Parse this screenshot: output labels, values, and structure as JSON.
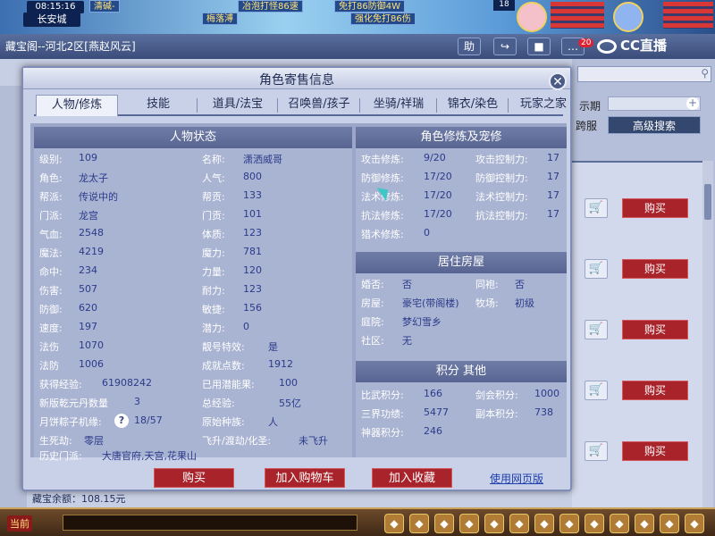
{
  "top_hud": {
    "clock": "08:15:16",
    "city": "长安城",
    "num": "18",
    "msgs": [
      "清碱-",
      "冶泡打怪86速",
      "免打86防御4W",
      "强化免打86伤"
    ],
    "hint": "梅落溥"
  },
  "outer": {
    "title": "藏宝阁--河北2区[燕赵风云]",
    "btn_help": "助",
    "msg_count": "20",
    "brand": "CC直播",
    "row1_label": "示期",
    "row2_label": "跨服",
    "adv_search": "高级搜索",
    "buy": "购买",
    "bottom_text": "藏宝余额：108.15元"
  },
  "dialog": {
    "title": "角色寄售信息",
    "tabs": [
      "人物/修炼",
      "技能",
      "道具/法宝",
      "召唤兽/孩子",
      "坐骑/祥瑞",
      "锦衣/染色",
      "玩家之家"
    ],
    "active_tab": 0
  },
  "char_status": {
    "title": "人物状态",
    "left": [
      {
        "k": "级别:",
        "v": "109"
      },
      {
        "k": "角色:",
        "v": "龙太子"
      },
      {
        "k": "帮派:",
        "v": "传说中的"
      },
      {
        "k": "门派:",
        "v": "龙宫"
      },
      {
        "k": "气血:",
        "v": "2548"
      },
      {
        "k": "魔法:",
        "v": "4219"
      },
      {
        "k": "命中:",
        "v": "234"
      },
      {
        "k": "伤害:",
        "v": "507"
      },
      {
        "k": "防御:",
        "v": "620"
      },
      {
        "k": "速度:",
        "v": "197"
      },
      {
        "k": "法伤",
        "v": "1070"
      },
      {
        "k": "法防",
        "v": "1006"
      }
    ],
    "right": [
      {
        "k": "名称:",
        "v": "潇洒威哥"
      },
      {
        "k": "人气:",
        "v": "800"
      },
      {
        "k": "帮贡:",
        "v": "133"
      },
      {
        "k": "门贡:",
        "v": "101"
      },
      {
        "k": "体质:",
        "v": "123"
      },
      {
        "k": "魔力:",
        "v": "781"
      },
      {
        "k": "力量:",
        "v": "120"
      },
      {
        "k": "耐力:",
        "v": "123"
      },
      {
        "k": "敏捷:",
        "v": "156"
      },
      {
        "k": "潜力:",
        "v": "0"
      },
      {
        "k": "靓号特效:",
        "v": "是"
      },
      {
        "k": "成就点数:",
        "v": "1912"
      }
    ],
    "exp_label": "获得经验:",
    "exp_value": "61908242",
    "potential_label": "已用潜能果:",
    "potential_value": "100",
    "qianyuan_label": "新版乾元丹数量",
    "qianyuan_value": "3",
    "total_exp_label": "总经验:",
    "total_exp_value": "55亿",
    "mooncake_label": "月饼粽子机缘:",
    "mooncake_help": "?",
    "mooncake_value": "18/57",
    "race_label": "原始种族:",
    "race_value": "人",
    "life_label": "生死劫:",
    "life_value": "零层",
    "ascend_label": "飞升/渡劫/化圣:",
    "ascend_value": "未飞升",
    "history_label": "历史门派:",
    "history_value": "大唐官府,天宫,花果山"
  },
  "practice": {
    "title": "角色修炼及宠修",
    "rows": [
      {
        "k1": "攻击修炼:",
        "v1": "9/20",
        "k2": "攻击控制力:",
        "v2": "17"
      },
      {
        "k1": "防御修炼:",
        "v1": "17/20",
        "k2": "防御控制力:",
        "v2": "17"
      },
      {
        "k1": "法术修炼:",
        "v1": "17/20",
        "k2": "法术控制力:",
        "v2": "17"
      },
      {
        "k1": "抗法修炼:",
        "v1": "17/20",
        "k2": "抗法控制力:",
        "v2": "17"
      },
      {
        "k1": "猎术修炼:",
        "v1": "0",
        "k2": "",
        "v2": ""
      }
    ]
  },
  "house": {
    "title": "居住房屋",
    "rows": [
      {
        "k1": "婚否:",
        "v1": "否",
        "k2": "同袍:",
        "v2": "否"
      },
      {
        "k1": "房屋:",
        "v1": "豪宅(带阁楼)",
        "k2": "牧场:",
        "v2": "初级"
      },
      {
        "k1": "庭院:",
        "v1": "梦幻雪乡",
        "k2": "",
        "v2": ""
      },
      {
        "k1": "社区:",
        "v1": "无",
        "k2": "",
        "v2": ""
      }
    ]
  },
  "score": {
    "title": "积分 其他",
    "rows": [
      {
        "k1": "比武积分:",
        "v1": "166",
        "k2": "剑会积分:",
        "v2": "1000"
      },
      {
        "k1": "三界功绩:",
        "v1": "5477",
        "k2": "副本积分:",
        "v2": "738"
      },
      {
        "k1": "神器积分:",
        "v1": "246",
        "k2": "",
        "v2": ""
      }
    ]
  },
  "footer": {
    "buy": "购买",
    "add_cart": "加入购物车",
    "add_fav": "加入收藏",
    "web_link": "使用网页版"
  },
  "bottom_bar": {
    "label": "当前"
  }
}
